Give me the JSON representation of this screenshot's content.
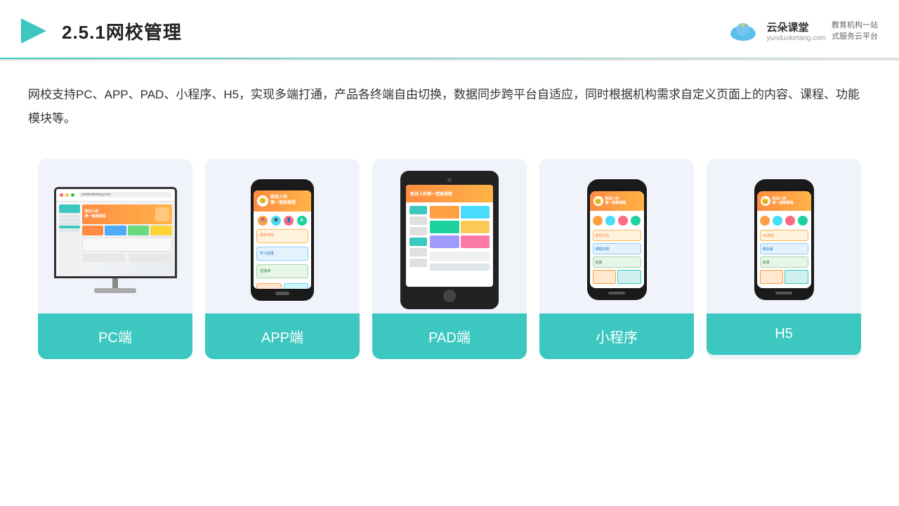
{
  "header": {
    "title": "2.5.1网校管理",
    "brand_name": "云朵课堂",
    "brand_url": "yunduoketang.com",
    "brand_tagline": "教育机构一站\n式服务云平台"
  },
  "description": {
    "text": "网校支持PC、APP、PAD、小程序、H5，实现多端打通，产品各终端自由切换，数据同步跨平台自适应，同时根据机构需求自定义页面上的内容、课程、功能模块等。"
  },
  "cards": [
    {
      "id": "pc",
      "label": "PC端"
    },
    {
      "id": "app",
      "label": "APP端"
    },
    {
      "id": "pad",
      "label": "PAD端"
    },
    {
      "id": "miniapp",
      "label": "小程序"
    },
    {
      "id": "h5",
      "label": "H5"
    }
  ]
}
